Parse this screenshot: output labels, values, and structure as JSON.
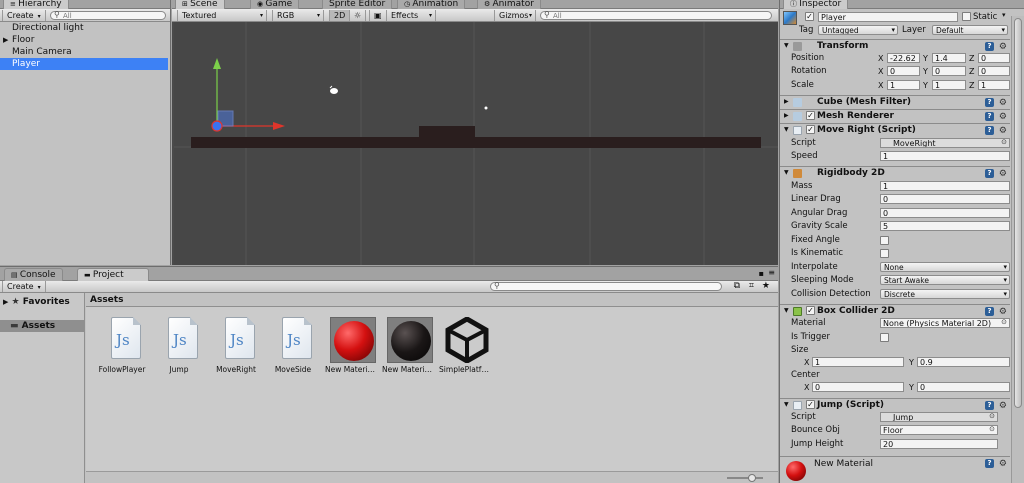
{
  "hierarchy": {
    "tab": "Hierarchy",
    "create_label": "Create",
    "search_placeholder": "All",
    "items": [
      {
        "label": "Directional light",
        "expandable": false
      },
      {
        "label": "Floor",
        "expandable": true
      },
      {
        "label": "Main Camera",
        "expandable": false
      },
      {
        "label": "Player",
        "expandable": false,
        "selected": true
      }
    ]
  },
  "scene": {
    "tabs": [
      "Scene",
      "Game",
      "Sprite Editor",
      "Animation",
      "Animator"
    ],
    "toolbar": {
      "render_mode": "Textured",
      "color_mode": "RGB",
      "mode_2d": "2D",
      "effects": "Effects",
      "gizmos": "Gizmos",
      "search_placeholder": "All"
    }
  },
  "project": {
    "tabs": [
      "Console",
      "Project"
    ],
    "create_label": "Create",
    "favorites_label": "Favorites",
    "assets_label": "Assets",
    "breadcrumb": "Assets",
    "assets": [
      {
        "name": "FollowPlayer",
        "type": "script"
      },
      {
        "name": "Jump",
        "type": "script"
      },
      {
        "name": "MoveRight",
        "type": "script"
      },
      {
        "name": "MoveSide",
        "type": "script"
      },
      {
        "name": "New Materi…",
        "type": "material",
        "color": "#d41010"
      },
      {
        "name": "New Materi…",
        "type": "material",
        "color": "#1a1616"
      },
      {
        "name": "SimplePlatf…",
        "type": "unity"
      }
    ]
  },
  "inspector": {
    "tab": "Inspector",
    "object_name": "Player",
    "static_label": "Static",
    "tag_label": "Tag",
    "tag_value": "Untagged",
    "layer_label": "Layer",
    "layer_value": "Default",
    "transform": {
      "title": "Transform",
      "position_label": "Position",
      "position": {
        "x": "-22.62",
        "y": "1.4",
        "z": "0"
      },
      "rotation_label": "Rotation",
      "rotation": {
        "x": "0",
        "y": "0",
        "z": "0"
      },
      "scale_label": "Scale",
      "scale": {
        "x": "1",
        "y": "1",
        "z": "1"
      }
    },
    "mesh_filter": {
      "title": "Cube (Mesh Filter)"
    },
    "mesh_renderer": {
      "title": "Mesh Renderer"
    },
    "move_right": {
      "title": "Move Right (Script)",
      "script_label": "Script",
      "script_value": "MoveRight",
      "speed_label": "Speed",
      "speed_value": "1"
    },
    "rigidbody": {
      "title": "Rigidbody 2D",
      "mass_label": "Mass",
      "mass": "1",
      "linear_drag_label": "Linear Drag",
      "linear_drag": "0",
      "angular_drag_label": "Angular Drag",
      "angular_drag": "0",
      "gravity_label": "Gravity Scale",
      "gravity": "5",
      "fixed_angle_label": "Fixed Angle",
      "kinematic_label": "Is Kinematic",
      "interpolate_label": "Interpolate",
      "interpolate": "None",
      "sleeping_label": "Sleeping Mode",
      "sleeping": "Start Awake",
      "collision_label": "Collision Detection",
      "collision": "Discrete"
    },
    "box_collider": {
      "title": "Box Collider 2D",
      "material_label": "Material",
      "material_value": "None (Physics Material 2D)",
      "trigger_label": "Is Trigger",
      "size_label": "Size",
      "size": {
        "x": "1",
        "y": "0.9"
      },
      "center_label": "Center",
      "center": {
        "x": "0",
        "y": "0"
      }
    },
    "jump": {
      "title": "Jump (Script)",
      "script_label": "Script",
      "script_value": "Jump",
      "bounce_label": "Bounce Obj",
      "bounce_value": "Floor",
      "height_label": "Jump Height",
      "height_value": "20"
    },
    "material_preview": {
      "title": "New Material"
    }
  },
  "colors": {
    "selection": "#3d81f5",
    "scene_bg": "#474747",
    "help_blue": "#2c5e97"
  }
}
